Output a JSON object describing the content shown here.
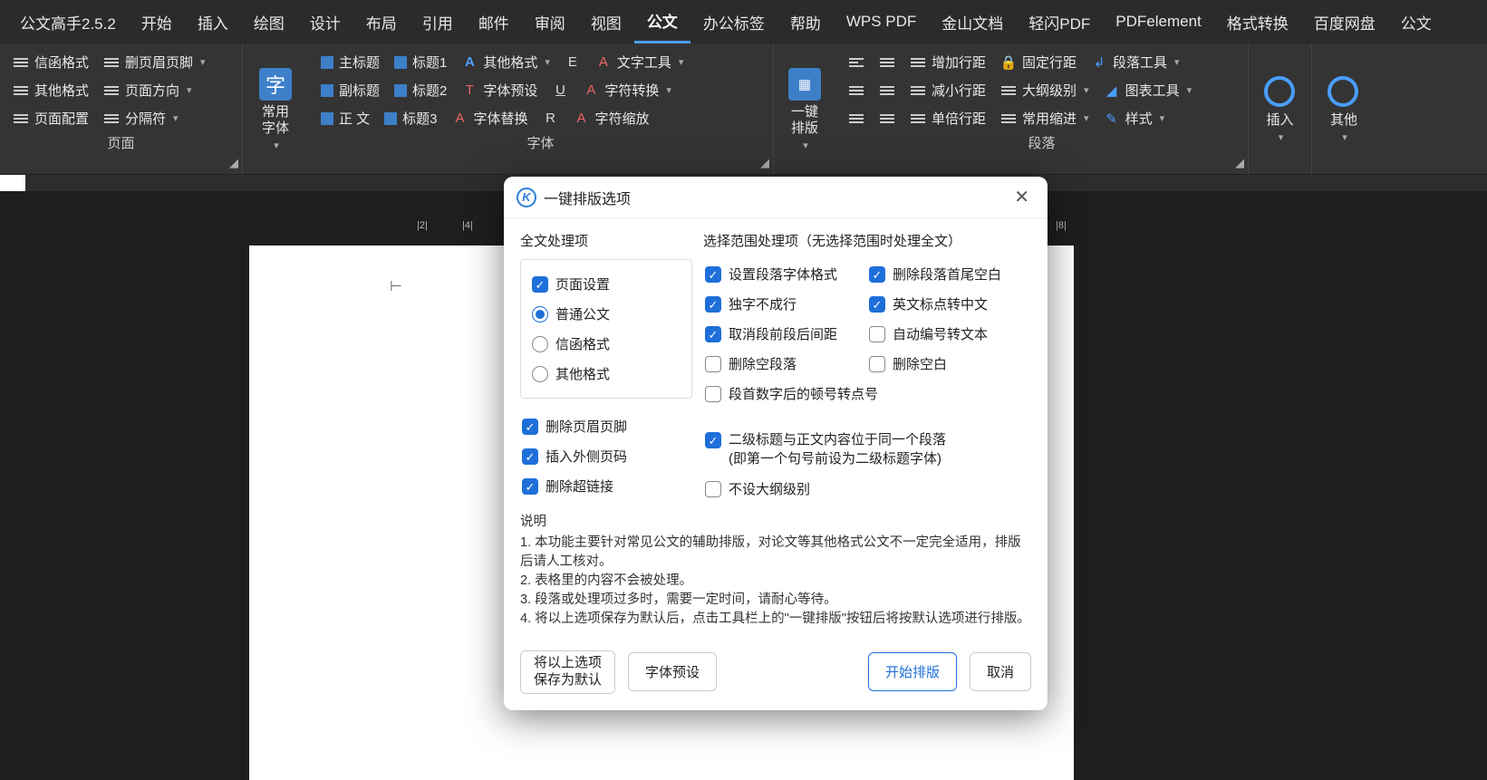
{
  "app": {
    "title": "公文高手2.5.2"
  },
  "menu": {
    "items": [
      "开始",
      "插入",
      "绘图",
      "设计",
      "布局",
      "引用",
      "邮件",
      "审阅",
      "视图",
      "公文",
      "办公标签",
      "帮助",
      "WPS PDF",
      "金山文档",
      "轻闪PDF",
      "PDFelement",
      "格式转换",
      "百度网盘",
      "公文"
    ],
    "active_index": 9
  },
  "ribbon": {
    "page": {
      "label": "页面",
      "btns": {
        "letter_fmt": "信函格式",
        "other_fmt": "其他格式",
        "page_cfg": "页面配置",
        "del_hf": "删页眉页脚",
        "page_dir": "页面方向",
        "sep": "分隔符"
      }
    },
    "font_big": {
      "label": "常用字体"
    },
    "font": {
      "label": "字体",
      "btns": {
        "main_title": "主标题",
        "sub_title": "副标题",
        "body": "正  文",
        "h1": "标题1",
        "h2": "标题2",
        "h3": "标题3",
        "other_fmt": "其他格式",
        "preset": "字体预设",
        "replace": "字体替换",
        "text_tool": "文字工具",
        "char_conv": "字符转换",
        "char_zoom": "字符缩放"
      }
    },
    "layout_big": {
      "label": "一键排版"
    },
    "para": {
      "label": "段落",
      "btns": {
        "inc_line": "增加行距",
        "dec_line": "减小行距",
        "single_line": "单倍行距",
        "fix_line": "固定行距",
        "outline": "大纲级别",
        "indent": "常用缩进",
        "para_tool": "段落工具",
        "chart_tool": "图表工具",
        "style": "样式"
      }
    },
    "insert": {
      "label": "插入"
    },
    "other": {
      "label": "其他"
    }
  },
  "ruler": {
    "marks": [
      "|2|",
      "|4|",
      "|8|"
    ]
  },
  "dialog": {
    "title": "一键排版选项",
    "left_title": "全文处理项",
    "right_title": "选择范围处理项（无选择范围时处理全文）",
    "page_setup": {
      "label": "页面设置",
      "checked": true
    },
    "doc_type": {
      "options": [
        {
          "label": "普通公文",
          "checked": true
        },
        {
          "label": "信函格式",
          "checked": false
        },
        {
          "label": "其他格式",
          "checked": false
        }
      ]
    },
    "left_checks": [
      {
        "label": "删除页眉页脚",
        "checked": true
      },
      {
        "label": "插入外侧页码",
        "checked": true
      },
      {
        "label": "删除超链接",
        "checked": true
      }
    ],
    "right_checks_a": [
      {
        "label": "设置段落字体格式",
        "checked": true
      },
      {
        "label": "删除段落首尾空白",
        "checked": true
      },
      {
        "label": "独字不成行",
        "checked": true
      },
      {
        "label": "英文标点转中文",
        "checked": true
      },
      {
        "label": "取消段前段后间距",
        "checked": true
      },
      {
        "label": "自动编号转文本",
        "checked": false
      },
      {
        "label": "删除空段落",
        "checked": false
      },
      {
        "label": "删除空白",
        "checked": false
      }
    ],
    "right_full_a": {
      "label": "段首数字后的顿号转点号",
      "checked": false
    },
    "right_full_b": {
      "label": "二级标题与正文内容位于同一个段落\n(即第一个句号前设为二级标题字体)",
      "checked": true
    },
    "right_full_c": {
      "label": "不设大纲级别",
      "checked": false
    },
    "explain": {
      "hd": "说明",
      "lines": [
        "1. 本功能主要针对常见公文的辅助排版，对论文等其他格式公文不一定完全适用，排版后请人工核对。",
        "2. 表格里的内容不会被处理。",
        "3. 段落或处理项过多时，需要一定时间，请耐心等待。",
        "4. 将以上选项保存为默认后，点击工具栏上的\"一键排版\"按钮后将按默认选项进行排版。"
      ]
    },
    "footer": {
      "save_default": "将以上选项\n保存为默认",
      "font_preset": "字体预设",
      "start": "开始排版",
      "cancel": "取消"
    }
  }
}
